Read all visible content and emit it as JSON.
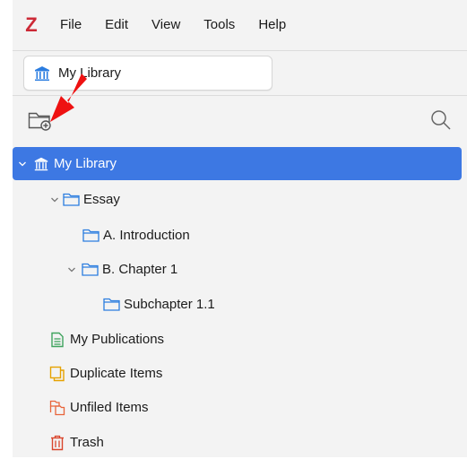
{
  "menubar": {
    "logo": "Z",
    "items": [
      "File",
      "Edit",
      "View",
      "Tools",
      "Help"
    ]
  },
  "tab": {
    "label": "My Library"
  },
  "tree": {
    "my_library": "My Library",
    "essay": "Essay",
    "introduction": "A. Introduction",
    "chapter1": "B. Chapter 1",
    "subchapter": "Subchapter 1.1",
    "publications": "My Publications",
    "duplicates": "Duplicate Items",
    "unfiled": "Unfiled Items",
    "trash": "Trash"
  },
  "colors": {
    "selected_bg": "#3d78e3",
    "folder_stroke": "#2b7de0",
    "publications": "#3fa35e",
    "duplicates": "#e6a200",
    "unfiled": "#e8643a",
    "trash": "#d9442b",
    "logo": "#cc2936",
    "arrow": "#ee1111"
  },
  "icons": {
    "library": "library-icon",
    "folder": "folder-icon",
    "new_collection": "new-collection-icon",
    "search": "search-icon"
  }
}
